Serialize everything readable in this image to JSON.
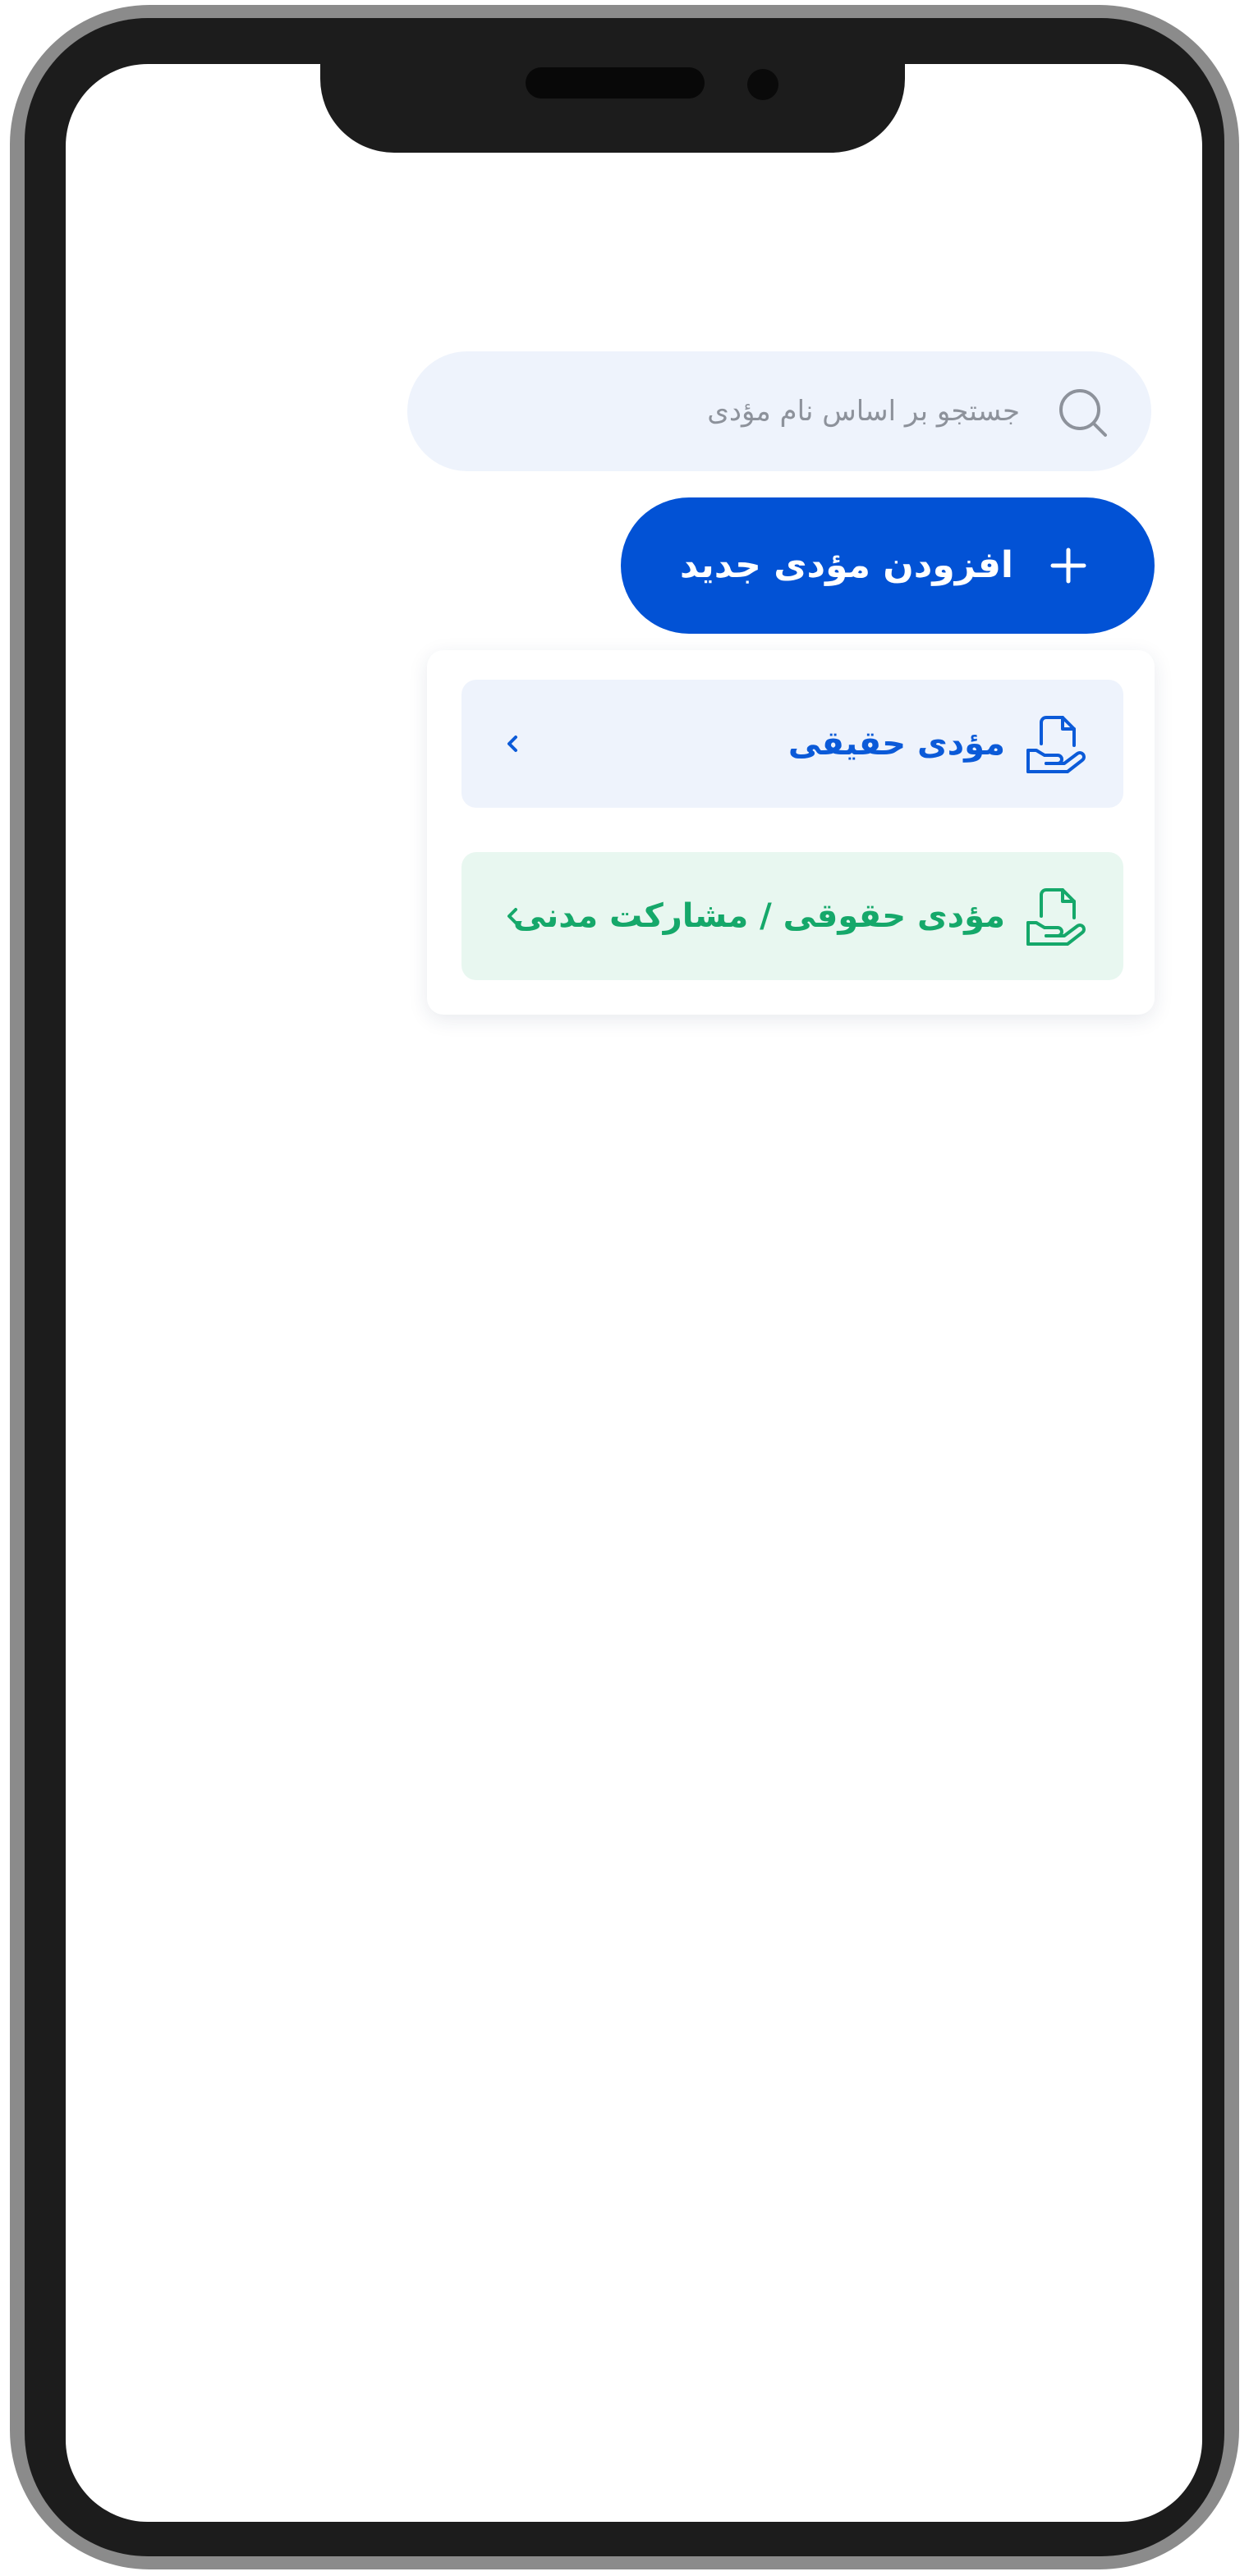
{
  "search": {
    "placeholder": "جستجو بر اساس نام مؤدی",
    "icon": "search-icon"
  },
  "add_button": {
    "label": "افزودن مؤدی جدید",
    "icon": "plus-icon"
  },
  "menu": {
    "items": [
      {
        "label": "مؤدی حقیقی",
        "icon": "document-hand-icon",
        "chevron": "chevron-icon",
        "color": "#0b5ad8"
      },
      {
        "label": "مؤدی حقوقی / مشارکت مدنی",
        "icon": "document-hand-icon",
        "chevron": "chevron-icon",
        "color": "#15a86a"
      }
    ]
  },
  "colors": {
    "primary": "#0252d5",
    "search_bg": "#eef3fc",
    "option_blue_bg": "#eef3fc",
    "option_green_bg": "#e8f7f0",
    "green": "#15a86a",
    "blue": "#0b5ad8"
  }
}
